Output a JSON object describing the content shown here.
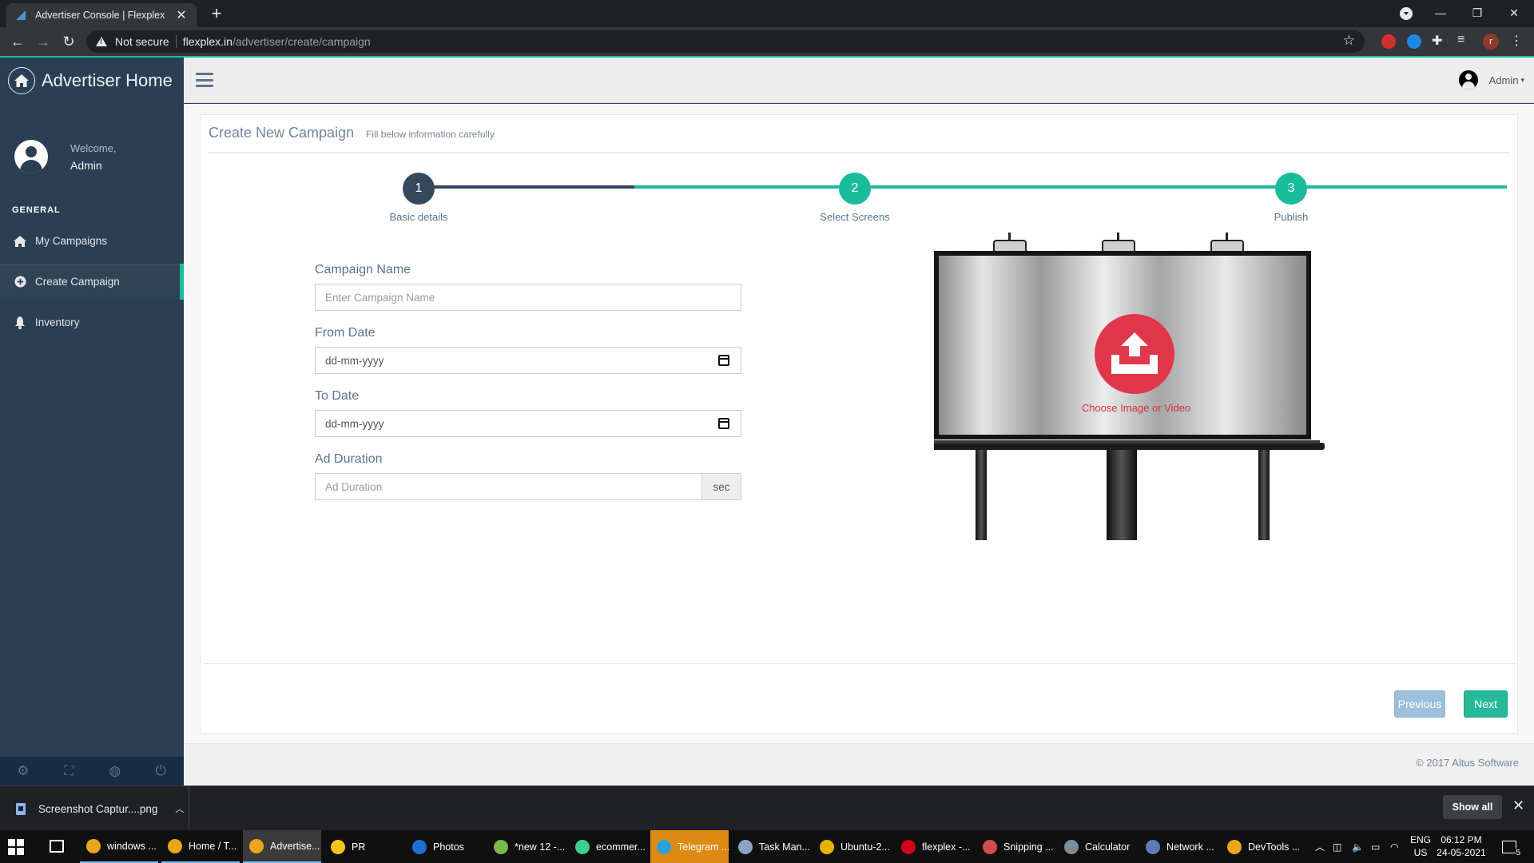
{
  "browser": {
    "tab_title": "Advertiser Console | Flexplex",
    "tab_close": "✕",
    "new_tab": "+",
    "security_label": "Not secure",
    "url_host": "flexplex.in",
    "url_path": "/advertiser/create/campaign",
    "profile_initial": "r"
  },
  "sidebar": {
    "brand": "Advertiser Home",
    "welcome": "Welcome,",
    "user_name": "Admin",
    "section_title": "GENERAL",
    "items": [
      {
        "label": "My Campaigns",
        "icon": "home-icon"
      },
      {
        "label": "Create Campaign",
        "icon": "plus-circle-icon",
        "active": true
      },
      {
        "label": "Inventory",
        "icon": "bell-icon"
      }
    ],
    "footer_icons": [
      "settings-icon",
      "fullscreen-icon",
      "lock-icon",
      "power-icon"
    ]
  },
  "topnav": {
    "user": "Admin"
  },
  "page": {
    "title": "Create New Campaign",
    "subtitle": "Fill below information carefully"
  },
  "wizard": {
    "steps": [
      {
        "number": "1",
        "label": "Basic details",
        "state": "current"
      },
      {
        "number": "2",
        "label": "Select Screens",
        "state": "upcoming"
      },
      {
        "number": "3",
        "label": "Publish",
        "state": "upcoming"
      }
    ]
  },
  "form": {
    "campaign_name_label": "Campaign Name",
    "campaign_name_placeholder": "Enter Campaign Name",
    "from_date_label": "From Date",
    "from_date_value": "dd-mm-yyyy",
    "to_date_label": "To Date",
    "to_date_value": "dd-mm-yyyy",
    "ad_duration_label": "Ad Duration",
    "ad_duration_placeholder": "Ad Duration",
    "ad_duration_unit": "sec"
  },
  "upload": {
    "label": "Choose Image or Video"
  },
  "actions": {
    "previous": "Previous",
    "next": "Next"
  },
  "footer": {
    "copyright": "© 2017 Altus Software"
  },
  "download_shelf": {
    "file_name": "Screenshot Captur....png",
    "show_all": "Show all"
  },
  "taskbar": {
    "apps": [
      {
        "label": "windows ...",
        "color": "#e9a61a",
        "open": true
      },
      {
        "label": "Home / T...",
        "color": "#e9a61a",
        "open": true
      },
      {
        "label": "Advertise...",
        "color": "#e9a61a",
        "open": true,
        "active": true
      },
      {
        "label": "PR",
        "color": "#f3c318"
      },
      {
        "label": "Photos",
        "color": "#1f6fd0"
      },
      {
        "label": "*new 12 -...",
        "color": "#79b84b"
      },
      {
        "label": "ecommer...",
        "color": "#3ccf8e"
      },
      {
        "label": "Telegram ...",
        "color": "#2aa1da",
        "telegram": true
      },
      {
        "label": "Task Man...",
        "color": "#8aa4c1"
      },
      {
        "label": "Ubuntu-2...",
        "color": "#e6b400"
      },
      {
        "label": "flexplex -...",
        "color": "#d0021b"
      },
      {
        "label": "Snipping ...",
        "color": "#d14b4b"
      },
      {
        "label": "Calculator",
        "color": "#7f8c97"
      },
      {
        "label": "Network ...",
        "color": "#5b7fb4"
      },
      {
        "label": "DevTools ...",
        "color": "#e9a61a"
      }
    ],
    "lang_top": "ENG",
    "lang_bottom": "US",
    "time": "06:12 PM",
    "date": "24-05-2021",
    "notif_count": "5"
  },
  "colors": {
    "accent": "#1abb9c",
    "sidebar_bg": "#2a3f54",
    "step_done": "#34495e",
    "upload_red": "#e1374d"
  }
}
